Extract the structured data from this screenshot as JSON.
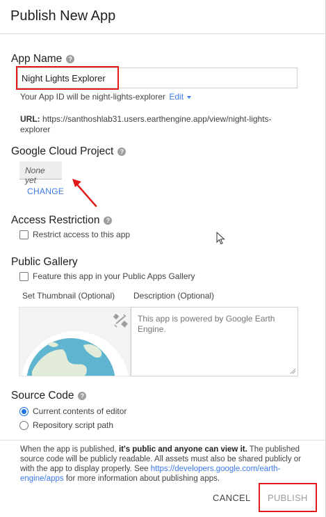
{
  "dialog": {
    "title": "Publish New App"
  },
  "app_name": {
    "heading": "App Name",
    "value": "Night Lights Explorer",
    "app_id_text": "Your App ID will be night-lights-explorer",
    "edit_label": "Edit",
    "url_label": "URL:",
    "url_value": "https://santhoshlab31.users.earthengine.app/view/night-lights-explorer"
  },
  "cloud_project": {
    "heading": "Google Cloud Project",
    "value": "None yet",
    "change_label": "CHANGE"
  },
  "access": {
    "heading": "Access Restriction",
    "checkbox_label": "Restrict access to this app",
    "checked": false
  },
  "gallery": {
    "heading": "Public Gallery",
    "checkbox_label": "Feature this app in your Public Apps Gallery",
    "checked": false,
    "thumbnail_label": "Set Thumbnail (Optional)",
    "description_label": "Description (Optional)",
    "description_value": "This app is powered by Google Earth Engine."
  },
  "source_code": {
    "heading": "Source Code",
    "options": [
      {
        "label": "Current contents of editor",
        "selected": true
      },
      {
        "label": "Repository script path",
        "selected": false
      }
    ]
  },
  "footer": {
    "notice_before": "When the app is published, ",
    "notice_bold": "it's public and anyone can view it.",
    "notice_mid": " The published source code will be publicly readable. All assets must also be shared publicly or with the app to display properly. See ",
    "notice_link": "https://developers.google.com/earth-engine/apps",
    "notice_after": " for more information about publishing apps.",
    "cancel_label": "CANCEL",
    "publish_label": "PUBLISH"
  },
  "colors": {
    "link": "#3b78e7",
    "highlight": "#e01919",
    "radio_selected": "#1a73e8"
  }
}
